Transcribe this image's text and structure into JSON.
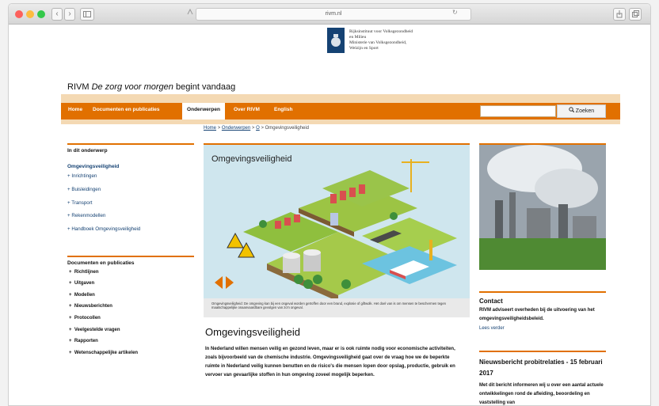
{
  "browser": {
    "url": "rivm.nl",
    "nav_back": "‹",
    "nav_forward": "›",
    "sidebar_icon": "sidebar-icon",
    "reader_icon": "reader-icon"
  },
  "logo": {
    "line1": "Rijksinstituut voor Volksgezondheid",
    "line2": "en Milieu",
    "line3": "Ministerie van Volksgezondheid,",
    "line4": "Welzijn en Sport"
  },
  "tagline": {
    "brand": "RIVM",
    "italic": "De zorg voor morgen",
    "rest": "begint vandaag"
  },
  "nav": {
    "items": [
      "Home",
      "Documenten en publicaties",
      "Onderwerpen",
      "Over RIVM",
      "English"
    ],
    "active_index": 2
  },
  "search": {
    "value": "",
    "button_label": "Zoeken"
  },
  "breadcrumb": {
    "home": "Home",
    "sep": ">",
    "level1": "Onderwerpen",
    "level2": "O",
    "current": "Omgevingsveiligheid"
  },
  "sidebar": {
    "section1_title": "In dit onderwerp",
    "active": "Omgevingsveiligheid",
    "links": [
      "Inrichtingen",
      "Buisleidingen",
      "Transport",
      "Rekenmodellen",
      "Handboek Omgevingsveiligheid"
    ],
    "section2_title": "Documenten en publicaties",
    "docs": [
      "Richtlijnen",
      "Uitgaven",
      "Modellen",
      "Nieuwsberichten",
      "Protocollen",
      "Veelgestelde vragen",
      "Rapporten",
      "Wetenschappelijke artikelen"
    ]
  },
  "hero": {
    "title": "Omgevingsveiligheid",
    "caption": "Omgevingsveiligheid: De omgeving kan bij een ongeval worden getroffen door een brand, explosie of giftwolk. Het doel van is om mensen te beschermen tegen maatschappelijke onaanvaardbare gevolgen van zo'n ongeval."
  },
  "main": {
    "title": "Omgevingsveiligheid",
    "intro": "In Nederland willen mensen veilig en gezond leven, maar er is ook ruimte nodig voor economische activiteiten, zoals bijvoorbeeld van de chemische industrie. Omgevingsveiligheid gaat over de vraag hoe we de beperkte ruimte in Nederland veilig kunnen benutten en de risico's die mensen lopen door opslag, productie, gebruik en vervoer van gevaarlijke stoffen in hun omgeving zoveel mogelijk beperken."
  },
  "right": {
    "contact_title": "Contact",
    "contact_text": "RIVM adviseert overheden bij de uitvoering van het omgevingsveiligheidsbeleid.",
    "contact_link": "Lees verder",
    "news_title": "Nieuwsbericht probitrelaties - 15 februari 2017",
    "news_text": "Met dit bericht informeren wij u over een aantal actuele ontwikkelingen rond de afleiding, beoordeling en vaststelling van"
  },
  "colors": {
    "accent": "#e17000",
    "brand_blue": "#154273",
    "nav_band": "#f4d9b3"
  }
}
